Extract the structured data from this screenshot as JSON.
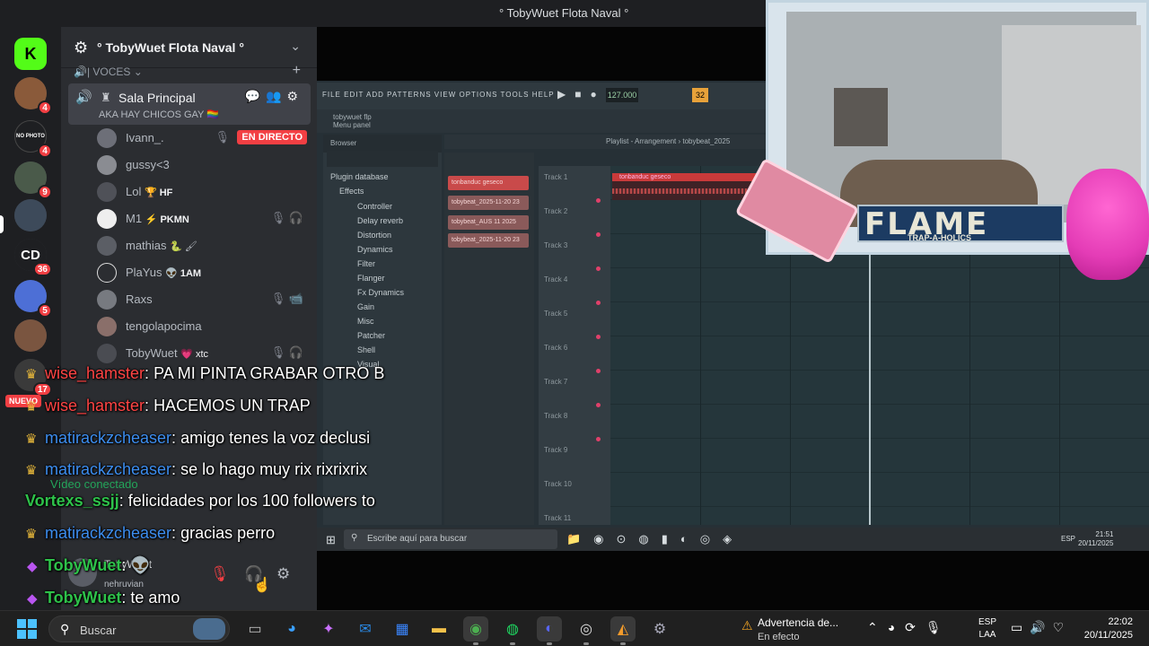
{
  "window": {
    "title": "° TobyWuet Flota Naval °"
  },
  "servers": [
    {
      "label": "K",
      "badge": "",
      "color": "#53fc18"
    },
    {
      "label": "",
      "badge": "4",
      "color": "#8a5a3a"
    },
    {
      "label": "NO PHOTO",
      "badge": "4",
      "color": "#1e1f22"
    },
    {
      "label": "",
      "badge": "9",
      "color": "#4a5a4a"
    },
    {
      "label": "",
      "badge": "",
      "color": "#3d4a5a"
    },
    {
      "label": "CD",
      "badge": "36",
      "color": "#1e1f22"
    },
    {
      "label": "",
      "badge": "5",
      "color": "#4d6fd6"
    },
    {
      "label": "",
      "badge": "",
      "color": "#7a5540"
    },
    {
      "label": "",
      "badge": "17",
      "color": "#3a3a3a"
    }
  ],
  "nuevo_badge": "NUEVO",
  "server": {
    "name": "° TobyWuet Flota Naval °",
    "category": "🔊| VOCES ⌄",
    "voice_channel": {
      "name": "Sala Principal",
      "subtitle": "AKA HAY CHICOS GAY 🏳️‍🌈"
    },
    "live_label": "EN DIRECTO",
    "voice_users": [
      {
        "name": "Ivann_.",
        "tag": ""
      },
      {
        "name": "gussy<3",
        "tag": ""
      },
      {
        "name": "Lol",
        "tag": "🏆 HF"
      },
      {
        "name": "M1",
        "tag": "⚡ PKMN"
      },
      {
        "name": "mathias",
        "tag": "🐍 🖌"
      },
      {
        "name": "PlaYus",
        "tag": "👽 1AM"
      },
      {
        "name": "Raxs",
        "tag": ""
      },
      {
        "name": "tengolapocima",
        "tag": ""
      },
      {
        "name": "TobyWuet",
        "tag": "💗 xtc"
      }
    ],
    "video_status": "Vídeo conectado",
    "user_panel": {
      "name": "TobyWuet",
      "status": "nehruvian"
    }
  },
  "fl_studio": {
    "menu": "FILE EDIT ADD PATTERNS VIEW OPTIONS TOOLS HELP",
    "tempo": "127.000",
    "pattern": "32",
    "hint": "tobywuet flp\nMenu panel",
    "browser_header": "Browser",
    "playlist_header": "Playlist - Arrangement › tobybeat_2025",
    "browser_items": [
      "Plugin database",
      "Effects",
      "Controller",
      "Delay reverb",
      "Distortion",
      "Dynamics",
      "Filter",
      "Flanger",
      "Fx Dynamics",
      "Gain",
      "Misc",
      "Patcher",
      "Shell",
      "Visual"
    ],
    "clips": [
      "tonbanduc geseco",
      "tobybeat_2025-11-20 23",
      "tobybeat_AUS 11 2025",
      "tobybeat_2025-11-20 23"
    ],
    "tracks": [
      "Track 1",
      "Track 2",
      "Track 3",
      "Track 4",
      "Track 5",
      "Track 6",
      "Track 7",
      "Track 8",
      "Track 9",
      "Track 10",
      "Track 11"
    ],
    "audio_clip": "tonbanduc geseco",
    "taskbar_search": "Escribe aquí para buscar",
    "taskbar_lang": "ESP",
    "taskbar_time": "21:51",
    "taskbar_date": "20/11/2025"
  },
  "overlay": {
    "brand": "FLAME",
    "tagline": "TRAP-A-HOLICS"
  },
  "chat": [
    {
      "user": "wise_hamster",
      "msg": "PA MI PINTA GRABAR OTRO B",
      "color": "#ff4444",
      "badge": "crown"
    },
    {
      "user": "wise_hamster",
      "msg": "HACEMOS UN TRAP",
      "color": "#ff4444",
      "badge": "crown"
    },
    {
      "user": "matirackzcheaser",
      "msg": "amigo tenes la voz declusi",
      "color": "#3d8ef0",
      "badge": "crown"
    },
    {
      "user": "matirackzcheaser",
      "msg": "se lo hago muy rix rixrixrix",
      "color": "#3d8ef0",
      "badge": "crown"
    },
    {
      "user": "Vortexs_ssjj",
      "msg": "felicidades por los 100 followers to",
      "color": "#2ec24a",
      "badge": ""
    },
    {
      "user": "matirackzcheaser",
      "msg": "gracias perro",
      "color": "#3d8ef0",
      "badge": "crown"
    },
    {
      "user": "TobyWuet",
      "msg": "👽",
      "color": "#2ec24a",
      "badge": "gem"
    },
    {
      "user": "TobyWuet",
      "msg": "te amo",
      "color": "#2ec24a",
      "badge": "gem"
    }
  ],
  "taskbar": {
    "search_placeholder": "Buscar",
    "notification_title": "Advertencia de...",
    "notification_sub": "En efecto",
    "lang_1": "ESP",
    "lang_2": "LAA",
    "time": "22:02",
    "date": "20/11/2025",
    "accent": "#4cc2ff"
  }
}
